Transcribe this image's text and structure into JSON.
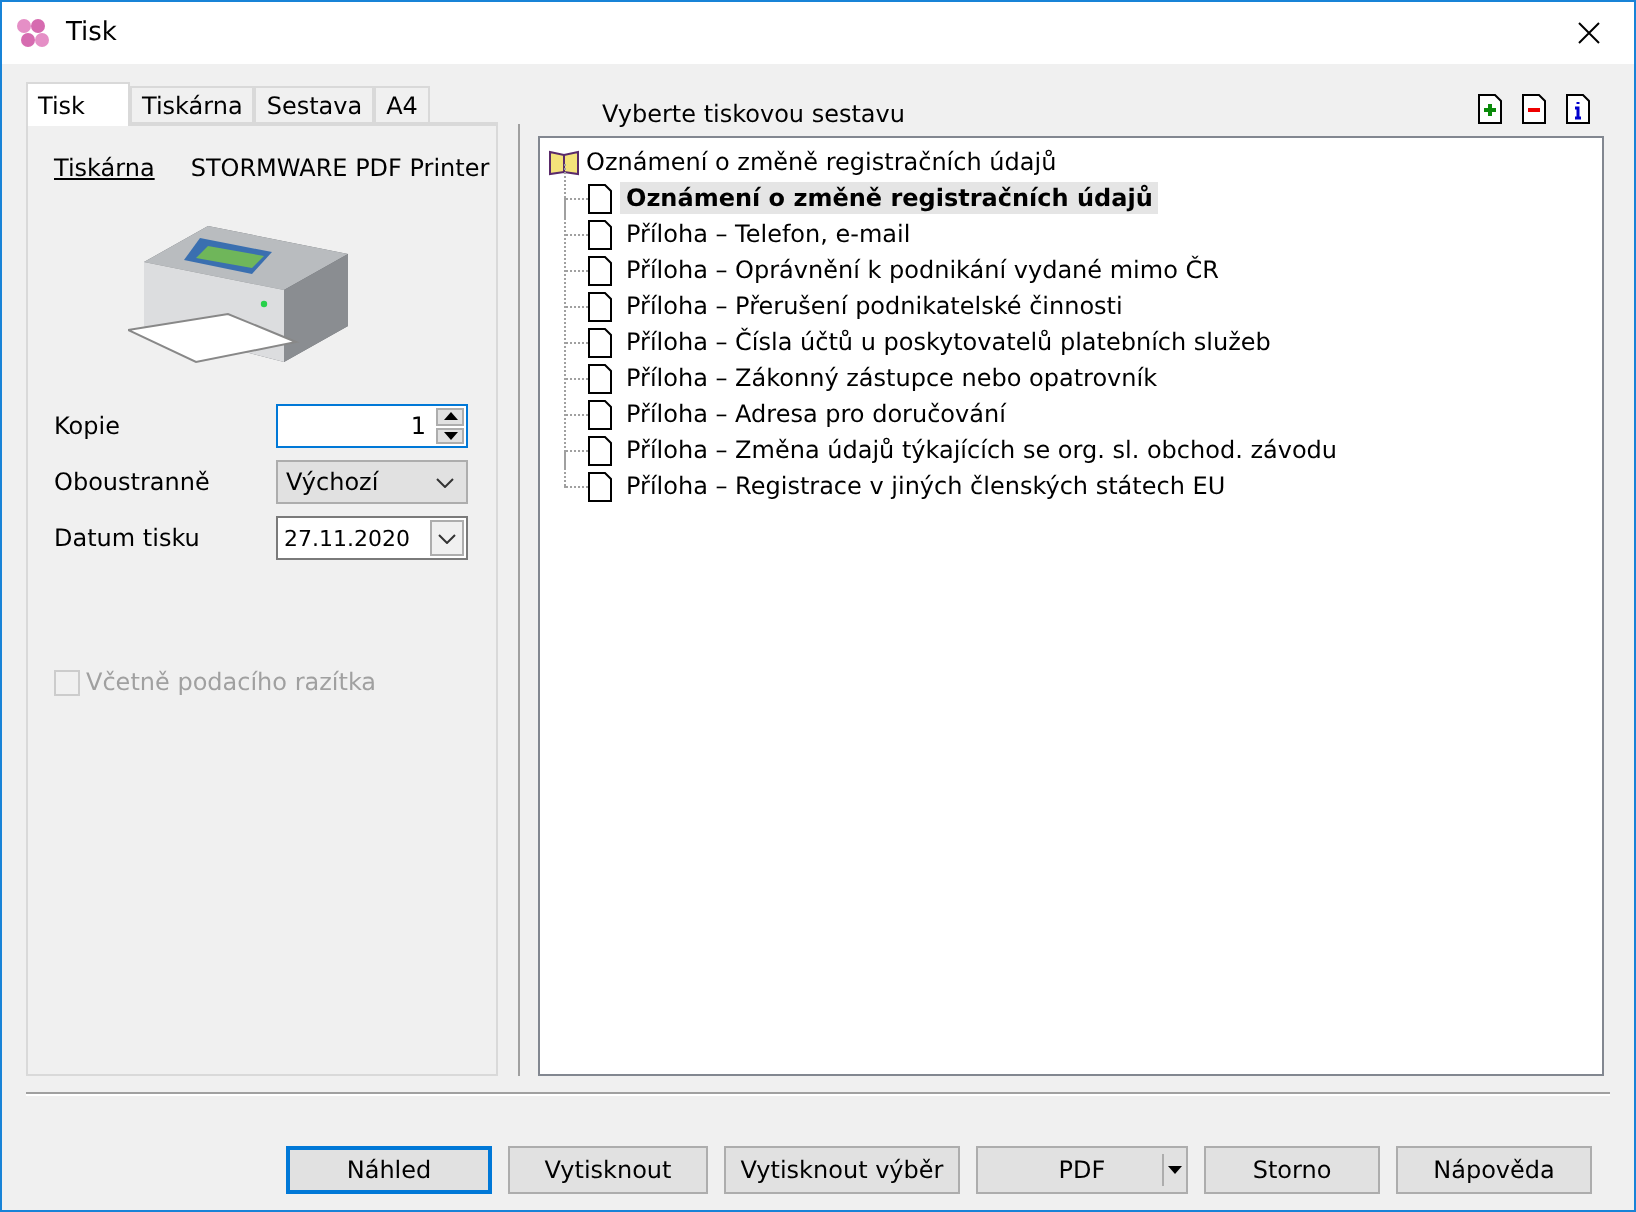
{
  "window": {
    "title": "Tisk"
  },
  "tabs": [
    {
      "label": "Tisk",
      "selected": true
    },
    {
      "label": "Tiskárna",
      "selected": false
    },
    {
      "label": "Sestava",
      "selected": false
    },
    {
      "label": "A4",
      "selected": false
    }
  ],
  "printer": {
    "link": "Tiskárna",
    "name": "STORMWARE PDF Printer"
  },
  "fields": [
    {
      "kind": "spin",
      "label": "Kopie",
      "value": "1",
      "focused": true
    },
    {
      "kind": "select",
      "label": "Oboustranně",
      "value": "Výchozí"
    },
    {
      "kind": "date",
      "label": "Datum tisku",
      "value": "27.11.2020"
    }
  ],
  "stamp_checkbox": {
    "label": "Včetně podacího razítka",
    "checked": false,
    "disabled": true
  },
  "report_header": "Vyberte tiskovou sestavu",
  "tree": {
    "label": "Oznámení o změně registračních údajů",
    "children": [
      {
        "label": "Oznámení o změně registračních údajů",
        "selected": true
      },
      {
        "label": "Příloha – Telefon, e-mail",
        "selected": false
      },
      {
        "label": "Příloha – Oprávnění k podnikání vydané mimo ČR",
        "selected": false
      },
      {
        "label": "Příloha – Přerušení podnikatelské činnosti",
        "selected": false
      },
      {
        "label": "Příloha – Čísla účtů u poskytovatelů platebních služeb",
        "selected": false
      },
      {
        "label": "Příloha – Zákonný zástupce nebo opatrovník",
        "selected": false
      },
      {
        "label": "Příloha – Adresa pro doručování",
        "selected": false
      },
      {
        "label": "Příloha – Změna údajů týkajících se org. sl. obchod. závodu",
        "selected": false
      },
      {
        "label": "Příloha – Registrace v jiných členských státech EU",
        "selected": false
      }
    ]
  },
  "buttons": [
    {
      "label": "Náhled",
      "kind": "default"
    },
    {
      "label": "Vytisknout",
      "kind": "normal"
    },
    {
      "label": "Vytisknout výběr",
      "kind": "normal"
    },
    {
      "label": "PDF",
      "kind": "split"
    },
    {
      "label": "Storno",
      "kind": "normal"
    },
    {
      "label": "Nápověda",
      "kind": "normal"
    }
  ]
}
